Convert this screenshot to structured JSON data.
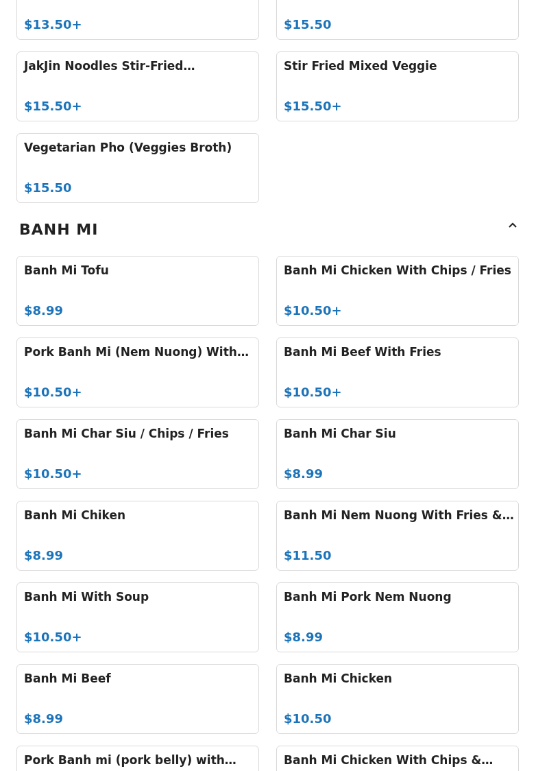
{
  "sections": [
    {
      "items": [
        {
          "price": "$13.50+"
        },
        {
          "price": "$15.50"
        },
        {
          "name": "JakJin Noodles Stir-Fried…",
          "price": "$15.50+"
        },
        {
          "name": "Stir Fried Mixed Veggie",
          "price": "$15.50+"
        },
        {
          "name": "Vegetarian Pho (Veggies Broth)",
          "price": "$15.50"
        }
      ]
    },
    {
      "title": "BANH MI",
      "expanded": true,
      "items": [
        {
          "name": "Banh Mi Tofu",
          "price": "$8.99"
        },
        {
          "name": "Banh Mi Chicken With Chips / Fries",
          "price": "$10.50+"
        },
        {
          "name": "Pork Banh Mi (Nem Nuong) With…",
          "price": "$10.50+"
        },
        {
          "name": "Banh Mi Beef With Fries",
          "price": "$10.50+"
        },
        {
          "name": "Banh Mi Char Siu / Chips / Fries",
          "price": "$10.50+"
        },
        {
          "name": "Banh Mi Char Siu",
          "price": "$8.99"
        },
        {
          "name": "Banh Mi Chiken",
          "price": "$8.99"
        },
        {
          "name": "Banh Mi Nem Nuong With Fries &…",
          "price": "$11.50"
        },
        {
          "name": "Banh Mi With Soup",
          "price": "$10.50+"
        },
        {
          "name": "Banh Mi Pork Nem Nuong",
          "price": "$8.99"
        },
        {
          "name": "Banh Mi Beef",
          "price": "$8.99"
        },
        {
          "name": "Banh Mi Chicken",
          "price": "$10.50"
        },
        {
          "name": "Pork Banh mi (pork belly) with…"
        },
        {
          "name": "Banh Mi Chicken With Chips &…"
        }
      ]
    }
  ]
}
